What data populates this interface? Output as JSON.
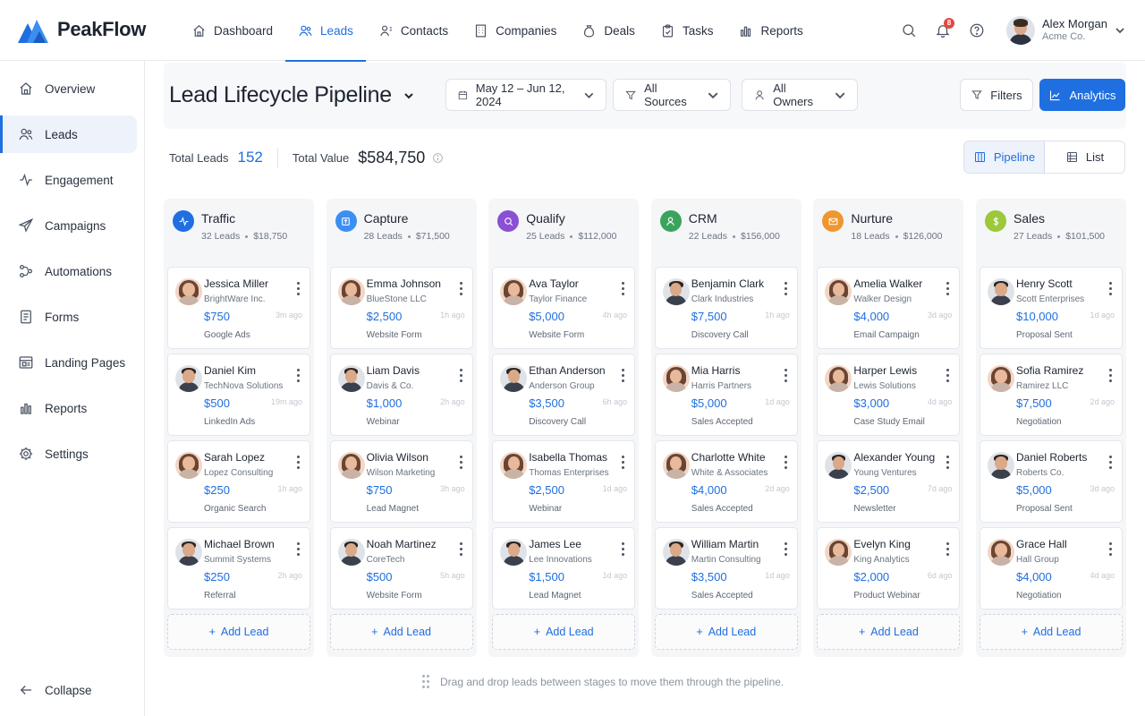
{
  "brand": {
    "name": "PeakFlow",
    "color": "#1f6fe0"
  },
  "topnav": [
    {
      "label": "Dashboard",
      "icon": "home-icon",
      "active": false
    },
    {
      "label": "Leads",
      "icon": "users-icon",
      "active": true
    },
    {
      "label": "Contacts",
      "icon": "contacts-icon",
      "active": false
    },
    {
      "label": "Companies",
      "icon": "building-icon",
      "active": false
    },
    {
      "label": "Deals",
      "icon": "money-bag-icon",
      "active": false
    },
    {
      "label": "Tasks",
      "icon": "clipboard-check-icon",
      "active": false
    },
    {
      "label": "Reports",
      "icon": "bar-chart-icon",
      "active": false
    }
  ],
  "notifications": {
    "count": "8"
  },
  "user": {
    "name": "Alex Morgan",
    "org": "Acme Co."
  },
  "sidebar": [
    {
      "label": "Overview",
      "icon": "home-icon",
      "active": false
    },
    {
      "label": "Leads",
      "icon": "users-icon",
      "active": true
    },
    {
      "label": "Engagement",
      "icon": "activity-icon",
      "active": false
    },
    {
      "label": "Campaigns",
      "icon": "send-icon",
      "active": false
    },
    {
      "label": "Automations",
      "icon": "flow-icon",
      "active": false
    },
    {
      "label": "Forms",
      "icon": "document-icon",
      "active": false
    },
    {
      "label": "Landing Pages",
      "icon": "browser-icon",
      "active": false
    },
    {
      "label": "Reports",
      "icon": "bar-chart-icon",
      "active": false
    },
    {
      "label": "Settings",
      "icon": "gear-icon",
      "active": false
    }
  ],
  "collapse_label": "Collapse",
  "page": {
    "title": "Lead Lifecycle Pipeline",
    "date_range": "May 12 – Jun 12, 2024",
    "sources": "All Sources",
    "owners": "All Owners",
    "filters_label": "Filters",
    "analytics_label": "Analytics"
  },
  "totals": {
    "leads_label": "Total Leads",
    "leads_value": "152",
    "value_label": "Total Value",
    "value_value": "$584,750"
  },
  "view_toggle": {
    "pipeline": "Pipeline",
    "list": "List",
    "active": "pipeline"
  },
  "stages": [
    {
      "name": "Traffic",
      "leads": "32 Leads",
      "value": "$18,750",
      "color": "#1f6fe0",
      "icon": "activity-icon",
      "cards": [
        {
          "name": "Jessica Miller",
          "company": "BrightWare Inc.",
          "value": "$750",
          "source": "Google Ads",
          "ago": "3m ago",
          "avatar": "female"
        },
        {
          "name": "Daniel Kim",
          "company": "TechNova Solutions",
          "value": "$500",
          "source": "LinkedIn Ads",
          "ago": "19m ago",
          "avatar": "male"
        },
        {
          "name": "Sarah Lopez",
          "company": "Lopez Consulting",
          "value": "$250",
          "source": "Organic Search",
          "ago": "1h ago",
          "avatar": "female"
        },
        {
          "name": "Michael Brown",
          "company": "Summit Systems",
          "value": "$250",
          "source": "Referral",
          "ago": "2h ago",
          "avatar": "male"
        }
      ]
    },
    {
      "name": "Capture",
      "leads": "28 Leads",
      "value": "$71,500",
      "color": "#3b8ff0",
      "icon": "upload-icon",
      "cards": [
        {
          "name": "Emma Johnson",
          "company": "BlueStone LLC",
          "value": "$2,500",
          "source": "Website Form",
          "ago": "1h ago",
          "avatar": "female"
        },
        {
          "name": "Liam Davis",
          "company": "Davis & Co.",
          "value": "$1,000",
          "source": "Webinar",
          "ago": "2h ago",
          "avatar": "male"
        },
        {
          "name": "Olivia Wilson",
          "company": "Wilson Marketing",
          "value": "$750",
          "source": "Lead Magnet",
          "ago": "3h ago",
          "avatar": "female"
        },
        {
          "name": "Noah Martinez",
          "company": "CoreTech",
          "value": "$500",
          "source": "Website Form",
          "ago": "5h ago",
          "avatar": "male"
        }
      ]
    },
    {
      "name": "Qualify",
      "leads": "25 Leads",
      "value": "$112,000",
      "color": "#8b4fd6",
      "icon": "search-icon",
      "cards": [
        {
          "name": "Ava Taylor",
          "company": "Taylor Finance",
          "value": "$5,000",
          "source": "Website Form",
          "ago": "4h ago",
          "avatar": "female"
        },
        {
          "name": "Ethan Anderson",
          "company": "Anderson Group",
          "value": "$3,500",
          "source": "Discovery Call",
          "ago": "6h ago",
          "avatar": "male"
        },
        {
          "name": "Isabella Thomas",
          "company": "Thomas Enterprises",
          "value": "$2,500",
          "source": "Webinar",
          "ago": "1d ago",
          "avatar": "female"
        },
        {
          "name": "James Lee",
          "company": "Lee Innovations",
          "value": "$1,500",
          "source": "Lead Magnet",
          "ago": "1d ago",
          "avatar": "male"
        }
      ]
    },
    {
      "name": "CRM",
      "leads": "22 Leads",
      "value": "$156,000",
      "color": "#3aa45c",
      "icon": "user-icon",
      "cards": [
        {
          "name": "Benjamin Clark",
          "company": "Clark Industries",
          "value": "$7,500",
          "source": "Discovery Call",
          "ago": "1h ago",
          "avatar": "male"
        },
        {
          "name": "Mia Harris",
          "company": "Harris Partners",
          "value": "$5,000",
          "source": "Sales Accepted",
          "ago": "1d ago",
          "avatar": "female"
        },
        {
          "name": "Charlotte White",
          "company": "White & Associates",
          "value": "$4,000",
          "source": "Sales Accepted",
          "ago": "2d ago",
          "avatar": "female"
        },
        {
          "name": "William Martin",
          "company": "Martin Consulting",
          "value": "$3,500",
          "source": "Sales Accepted",
          "ago": "1d ago",
          "avatar": "male"
        }
      ]
    },
    {
      "name": "Nurture",
      "leads": "18 Leads",
      "value": "$126,000",
      "color": "#f0962e",
      "icon": "mail-icon",
      "cards": [
        {
          "name": "Amelia Walker",
          "company": "Walker Design",
          "value": "$4,000",
          "source": "Email Campaign",
          "ago": "3d ago",
          "avatar": "female"
        },
        {
          "name": "Harper Lewis",
          "company": "Lewis Solutions",
          "value": "$3,000",
          "source": "Case Study Email",
          "ago": "4d ago",
          "avatar": "female"
        },
        {
          "name": "Alexander Young",
          "company": "Young Ventures",
          "value": "$2,500",
          "source": "Newsletter",
          "ago": "7d ago",
          "avatar": "male"
        },
        {
          "name": "Evelyn King",
          "company": "King Analytics",
          "value": "$2,000",
          "source": "Product Webinar",
          "ago": "6d ago",
          "avatar": "female"
        }
      ]
    },
    {
      "name": "Sales",
      "leads": "27 Leads",
      "value": "$101,500",
      "color": "#9cc83a",
      "icon": "dollar-icon",
      "cards": [
        {
          "name": "Henry Scott",
          "company": "Scott Enterprises",
          "value": "$10,000",
          "source": "Proposal Sent",
          "ago": "1d ago",
          "avatar": "male"
        },
        {
          "name": "Sofia Ramirez",
          "company": "Ramirez LLC",
          "value": "$7,500",
          "source": "Negotiation",
          "ago": "2d ago",
          "avatar": "female"
        },
        {
          "name": "Daniel Roberts",
          "company": "Roberts Co.",
          "value": "$5,000",
          "source": "Proposal Sent",
          "ago": "3d ago",
          "avatar": "male"
        },
        {
          "name": "Grace Hall",
          "company": "Hall Group",
          "value": "$4,000",
          "source": "Negotiation",
          "ago": "4d ago",
          "avatar": "female"
        }
      ]
    }
  ],
  "add_lead_label": "Add Lead",
  "hint": "Drag and drop leads between stages to move them through the pipeline."
}
